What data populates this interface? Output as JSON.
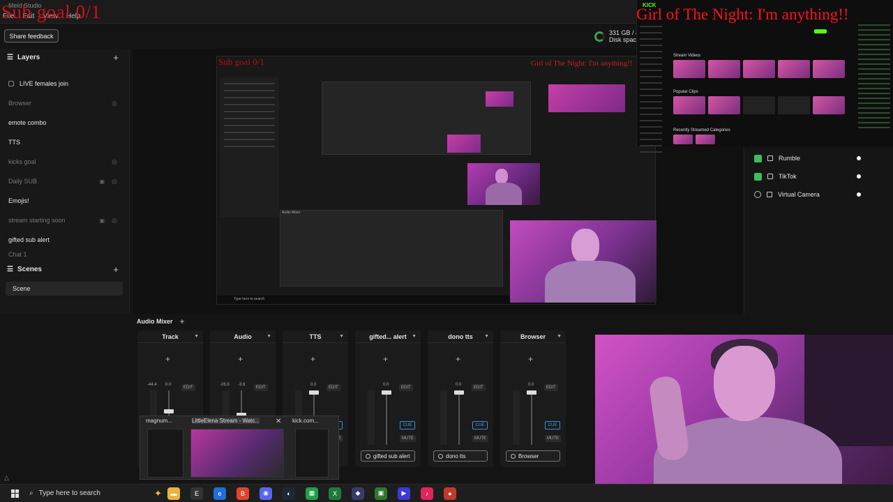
{
  "titlebar": {
    "app_title": "Meld Studio",
    "menu": [
      "File",
      "Edit",
      "View",
      "Help"
    ]
  },
  "overlays": {
    "sub_goal": "Sub goal 0/1",
    "now_playing": "Girl of The Night: I'm anything!!"
  },
  "toolbar": {
    "feedback_label": "Share feedback"
  },
  "disk": {
    "line1": "331 GB / 4",
    "line2": "Disk spac"
  },
  "layers": {
    "title": "Layers",
    "items": [
      {
        "label": "LIVE females join",
        "dim": false
      },
      {
        "label": "Browser",
        "dim": true
      },
      {
        "label": "emote combo",
        "dim": false
      },
      {
        "label": "TTS",
        "dim": false
      },
      {
        "label": "kicks goal",
        "dim": true
      },
      {
        "label": "Daily SUB",
        "dim": true
      },
      {
        "label": "Emojis!",
        "dim": false
      },
      {
        "label": "stream starting soon",
        "dim": true
      },
      {
        "label": "gifted sub alert",
        "dim": false
      },
      {
        "label": "Chat 1",
        "dim": true
      }
    ]
  },
  "scenes": {
    "title": "Scenes",
    "items": [
      "Scene"
    ]
  },
  "destinations": [
    {
      "label": "Rumble",
      "icon": "rumble-icon"
    },
    {
      "label": "TikTok",
      "icon": "tiktok-icon"
    },
    {
      "label": "Virtual Camera",
      "icon": "camera-icon"
    }
  ],
  "kick": {
    "logo": "KICK",
    "section_videos": "Stream Videos",
    "section_clips": "Popular Clips",
    "section_categories": "Recently Streamed Categories"
  },
  "nested_preview": {
    "audio_mixer": "Audio Mixer",
    "search": "Type here to search"
  },
  "mixer": {
    "title": "Audio Mixer",
    "channels": [
      {
        "name": "Track",
        "db_left": "-44.4",
        "db_right": "0.0",
        "level": 0.62,
        "source": ""
      },
      {
        "name": "Audio",
        "db_left": "-26.9",
        "db_right": "-3.6",
        "level": 0.55,
        "source": ""
      },
      {
        "name": "TTS",
        "db_left": "",
        "db_right": "0.0",
        "level": 1.0,
        "source": ""
      },
      {
        "name": "gifted... alert",
        "db_left": "",
        "db_right": "0.0",
        "level": 1.0,
        "source": "gifted sub alert"
      },
      {
        "name": "dono tts",
        "db_left": "",
        "db_right": "0.0",
        "level": 1.0,
        "source": "dono tts"
      },
      {
        "name": "Browser",
        "db_left": "",
        "db_right": "0.0",
        "level": 1.0,
        "source": "Browser"
      }
    ],
    "edit_label": "EDIT",
    "cue_label": "CUE",
    "mute_label": "MUTE"
  },
  "taskbar_popup": {
    "items": [
      {
        "label": "magnum..."
      },
      {
        "label": "LittleElena Stream - Watc..."
      },
      {
        "label": "kick.com..."
      }
    ]
  },
  "taskbar": {
    "search_placeholder": "Type here to search",
    "icons": [
      "files-icon",
      "epic-icon",
      "edge-icon",
      "brave-icon",
      "discord-icon",
      "steam-icon",
      "spreadsheet-icon",
      "xbox-icon",
      "shield-icon",
      "minecraft-icon",
      "media-icon",
      "tiktok-icon",
      "app-icon"
    ]
  },
  "colors": {
    "overlay_red": "#d0101a",
    "kick_green": "#53fc18",
    "cue_blue": "#4aa0f0",
    "panel_bg": "#181818"
  }
}
